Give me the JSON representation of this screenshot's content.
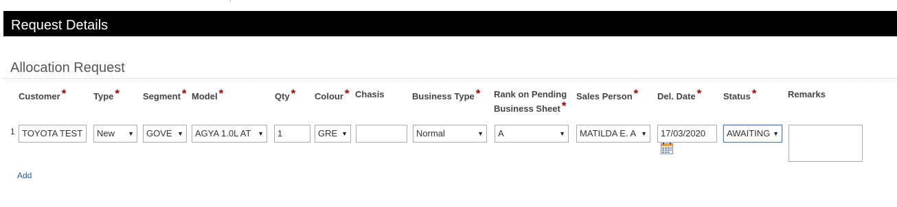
{
  "header": {
    "title": "Request Details"
  },
  "section": {
    "title": "Allocation Request"
  },
  "columns": {
    "customer": "Customer",
    "type": "Type",
    "segment": "Segment",
    "model": "Model",
    "qty": "Qty",
    "colour": "Colour",
    "chasis": "Chasis",
    "business_type": "Business Type",
    "rank_line1": "Rank on Pending",
    "rank_line2": "Business Sheet",
    "sales_person": "Sales Person",
    "del_date": "Del. Date",
    "status": "Status",
    "remarks": "Remarks"
  },
  "required_mark": "*",
  "row": {
    "number": "1",
    "customer": "TOYOTA TEST",
    "type": "New",
    "segment": "GOVE",
    "model": "AGYA 1.0L AT",
    "qty": "1",
    "colour": "GRE",
    "chasis": "",
    "business_type": "Normal",
    "rank": "A",
    "sales_person": "MATILDA E. A",
    "del_date": "17/03/2020",
    "status": "AWAITING",
    "remarks": ""
  },
  "actions": {
    "add_label": "Add"
  },
  "icons": {
    "dropdown": "dropdown-arrow-icon",
    "calendar": "calendar-icon"
  },
  "colors": {
    "header_bg": "#000000",
    "required": "#aa0000",
    "link": "#1a5f9e",
    "focus": "#3d7fc1"
  }
}
